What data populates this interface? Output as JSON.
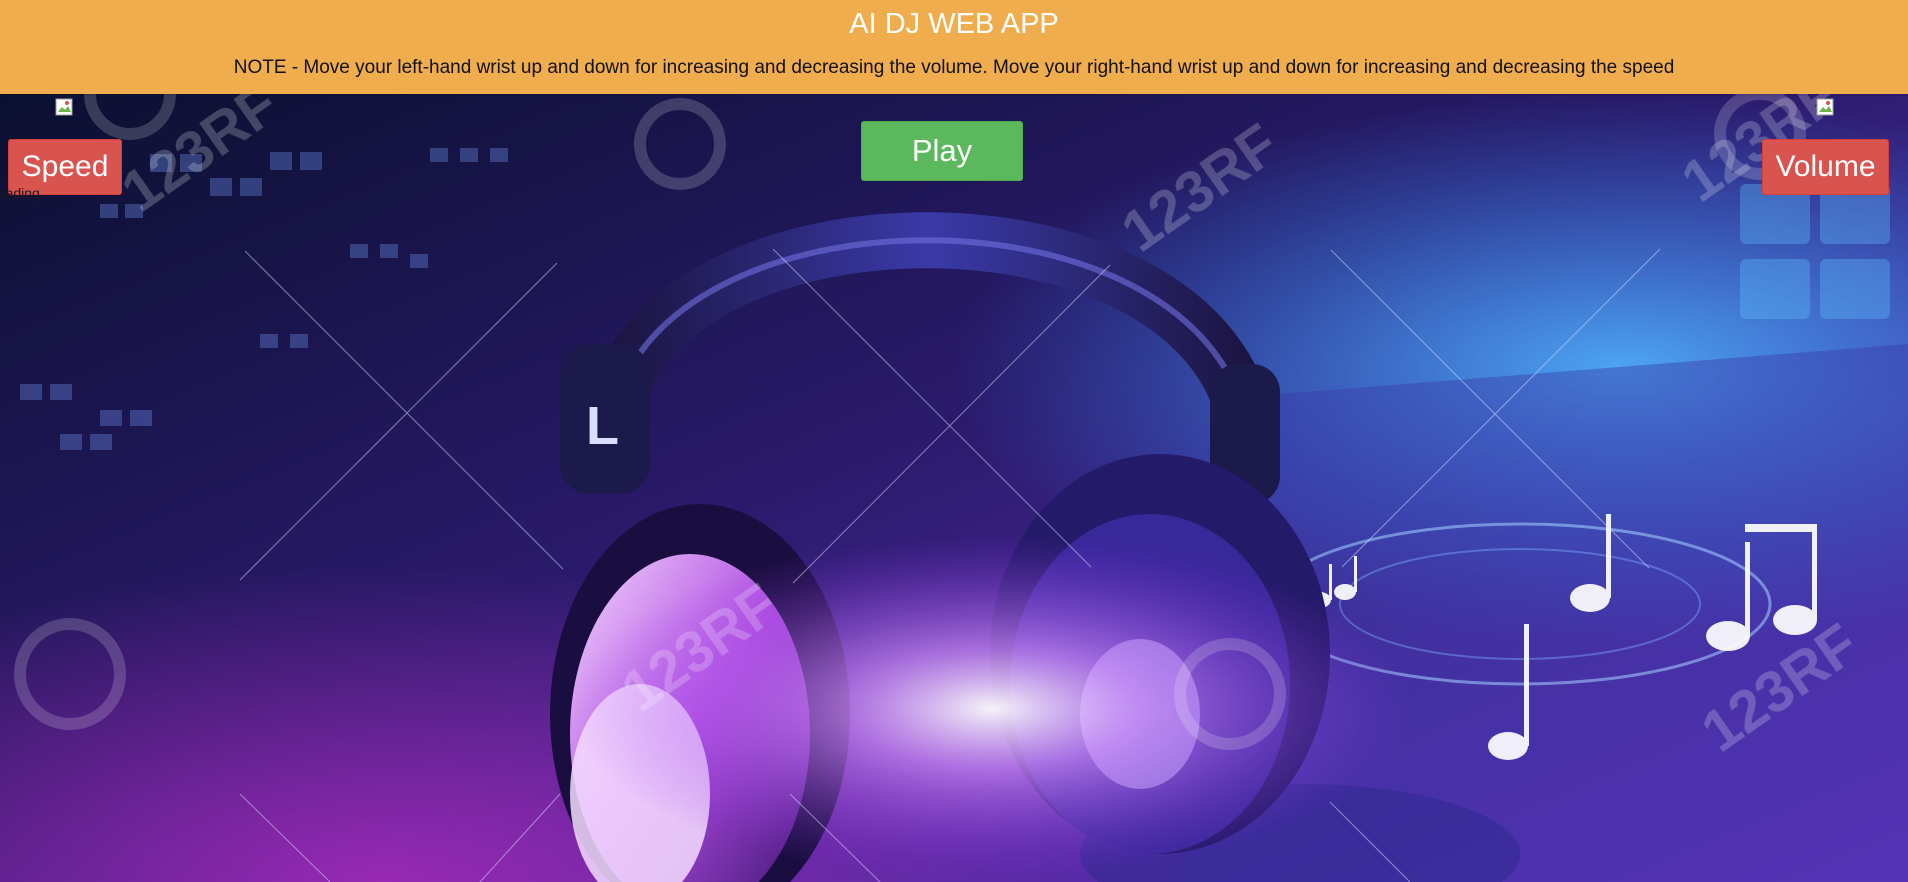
{
  "header": {
    "title": "AI DJ WEB APP",
    "note": "NOTE - Move your left-hand wrist up and down for increasing and decreasing the volume. Move your right-hand wrist up and down for increasing and decreasing the speed"
  },
  "controls": {
    "speed_label": "Speed",
    "volume_label": "Volume",
    "play_label": "Play",
    "status_text": "Loading"
  },
  "images": {
    "left_alt": "",
    "right_alt": ""
  },
  "background": {
    "watermark_text": "123RF",
    "icons": [
      "headphones-icon",
      "music-note-icon",
      "treble-clef-icon"
    ]
  },
  "colors": {
    "header_bg": "#f0ad4e",
    "danger": "#d9534f",
    "success": "#5cb85c",
    "scene_dark": "#120a33",
    "scene_violet": "#8a2be2",
    "scene_blue": "#2f8cff"
  }
}
